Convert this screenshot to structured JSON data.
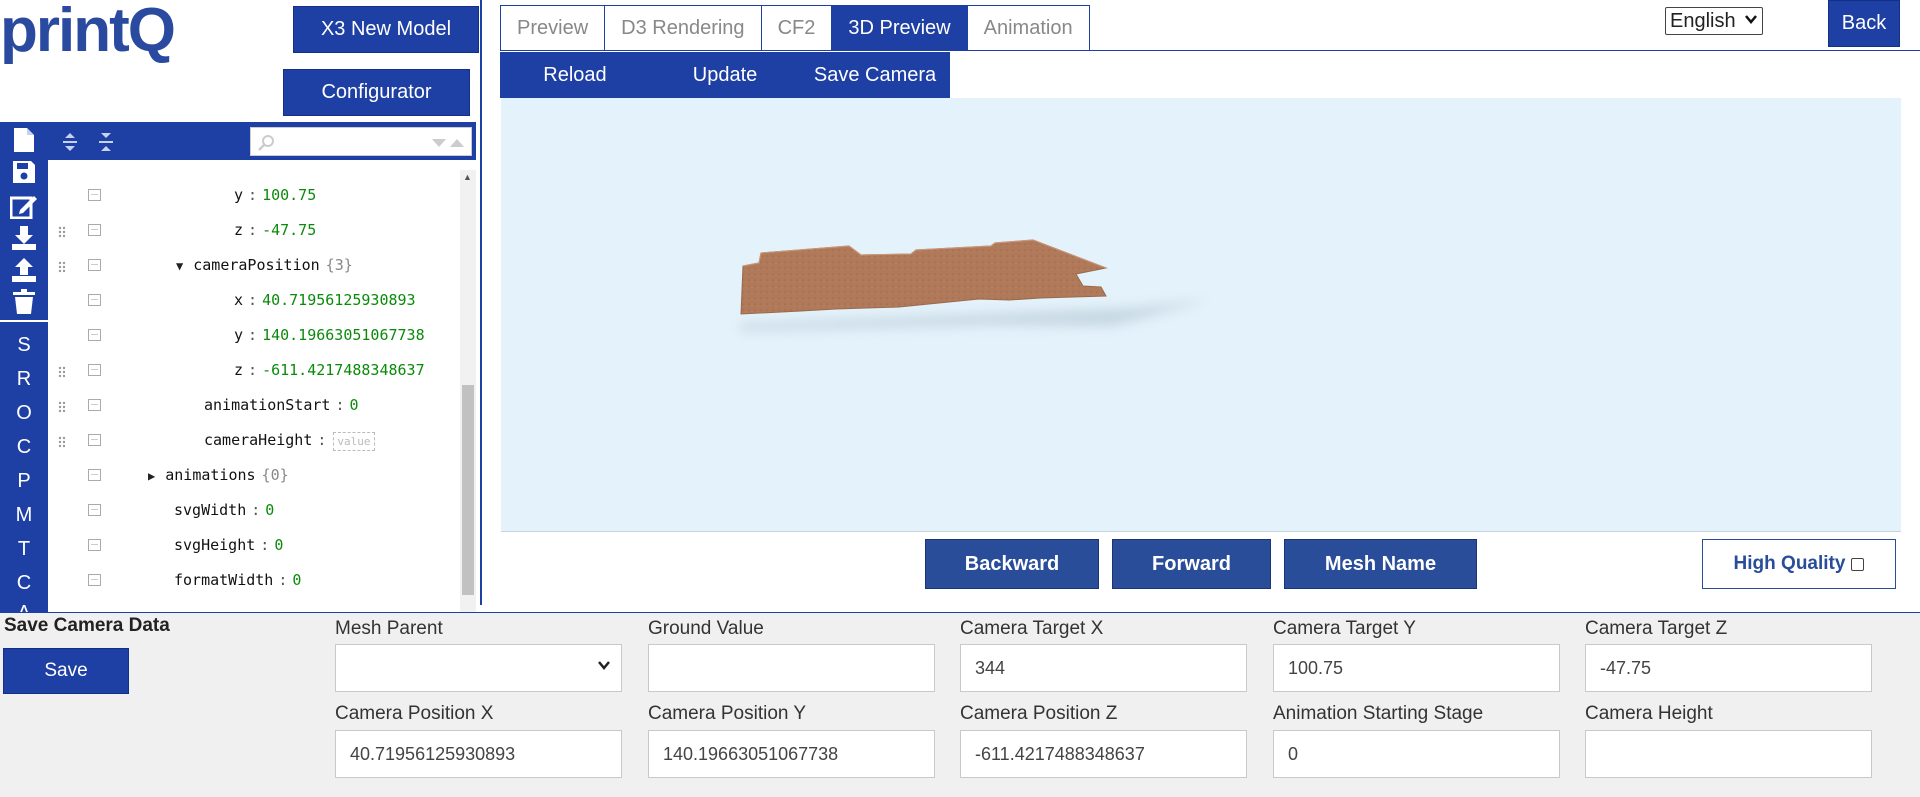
{
  "brand": {
    "logo": "printQ"
  },
  "top_buttons": {
    "x3_new_model": "X3 New Model",
    "configurator": "Configurator",
    "back": "Back"
  },
  "tabs": [
    {
      "label": "Preview",
      "active": false
    },
    {
      "label": "D3 Rendering",
      "active": false
    },
    {
      "label": "CF2",
      "active": false
    },
    {
      "label": "3D Preview",
      "active": true
    },
    {
      "label": "Animation",
      "active": false
    }
  ],
  "subbar": {
    "reload": "Reload",
    "update": "Update",
    "save_camera": "Save Camera"
  },
  "language": {
    "selected": "English"
  },
  "viewport_controls": {
    "backward": "Backward",
    "forward": "Forward",
    "mesh_name": "Mesh Name",
    "high_quality": "High Quality",
    "high_quality_checked": false
  },
  "side_letters": [
    "S",
    "R",
    "O",
    "C",
    "P",
    "M",
    "T",
    "C",
    "A"
  ],
  "tree_rows": [
    {
      "key": "y",
      "sep": ":",
      "value": "100.75"
    },
    {
      "key": "z",
      "sep": ":",
      "value": "-47.75"
    },
    {
      "key": "cameraPosition",
      "count": "{3}",
      "expanded": true
    },
    {
      "key": "x",
      "sep": ":",
      "value": "40.71956125930893"
    },
    {
      "key": "y",
      "sep": ":",
      "value": "140.19663051067738"
    },
    {
      "key": "z",
      "sep": ":",
      "value": "-611.4217488348637"
    },
    {
      "key": "animationStart",
      "sep": ":",
      "value": "0"
    },
    {
      "key": "cameraHeight",
      "sep": ":",
      "placeholder": "value"
    },
    {
      "key": "animations",
      "count": "{0}",
      "expanded": false
    },
    {
      "key": "svgWidth",
      "sep": ":",
      "value": "0"
    },
    {
      "key": "svgHeight",
      "sep": ":",
      "value": "0"
    },
    {
      "key": "formatWidth",
      "sep": ":",
      "value": "0"
    }
  ],
  "camera_form": {
    "section_title": "Save Camera Data",
    "save_button": "Save",
    "mesh_parent": {
      "label": "Mesh Parent",
      "value": ""
    },
    "ground_value": {
      "label": "Ground Value",
      "value": ""
    },
    "camera_target_x": {
      "label": "Camera Target X",
      "value": "344"
    },
    "camera_target_y": {
      "label": "Camera Target Y",
      "value": "100.75"
    },
    "camera_target_z": {
      "label": "Camera Target Z",
      "value": "-47.75"
    },
    "camera_position_x": {
      "label": "Camera Position X",
      "value": "40.71956125930893"
    },
    "camera_position_y": {
      "label": "Camera Position Y",
      "value": "140.19663051067738"
    },
    "camera_position_z": {
      "label": "Camera Position Z",
      "value": "-611.4217488348637"
    },
    "animation_starting_stage": {
      "label": "Animation Starting Stage",
      "value": "0"
    },
    "camera_height": {
      "label": "Camera Height",
      "value": ""
    }
  },
  "colors": {
    "primary": "#1e3fa3",
    "viewport_bg": "#e4f2fb",
    "model": "#b07a5a",
    "tree_value": "#0a8a0a"
  }
}
